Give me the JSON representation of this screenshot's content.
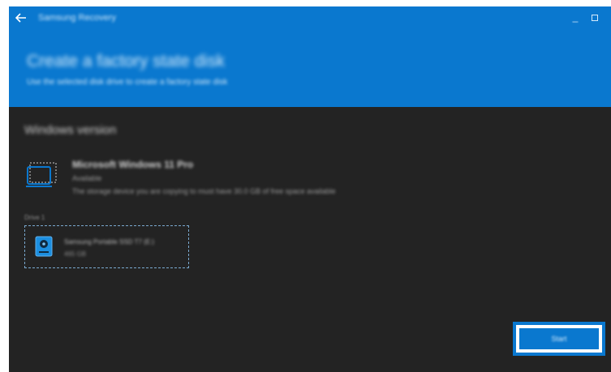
{
  "window": {
    "app_title": "Samsung Recovery",
    "minimize_glyph": "_"
  },
  "header": {
    "title": "Create a factory state disk",
    "subtitle": "Use the selected disk drive to create a factory state disk"
  },
  "section": {
    "title": "Windows version"
  },
  "os": {
    "icon": "laptop-icon",
    "name": "Microsoft Windows 11 Pro",
    "status": "Available",
    "note": "The storage device you are copying to must have 30.0 GB of free space available"
  },
  "drive": {
    "label": "Drive 1",
    "icon": "usb-drive-icon",
    "name": "Samsung Portable SSD T7 (E:)",
    "size": "465 GB"
  },
  "actions": {
    "start_label": "Start"
  },
  "colors": {
    "accent": "#0a78cf",
    "background": "#232323",
    "highlight_outline": "#0a78cf"
  }
}
